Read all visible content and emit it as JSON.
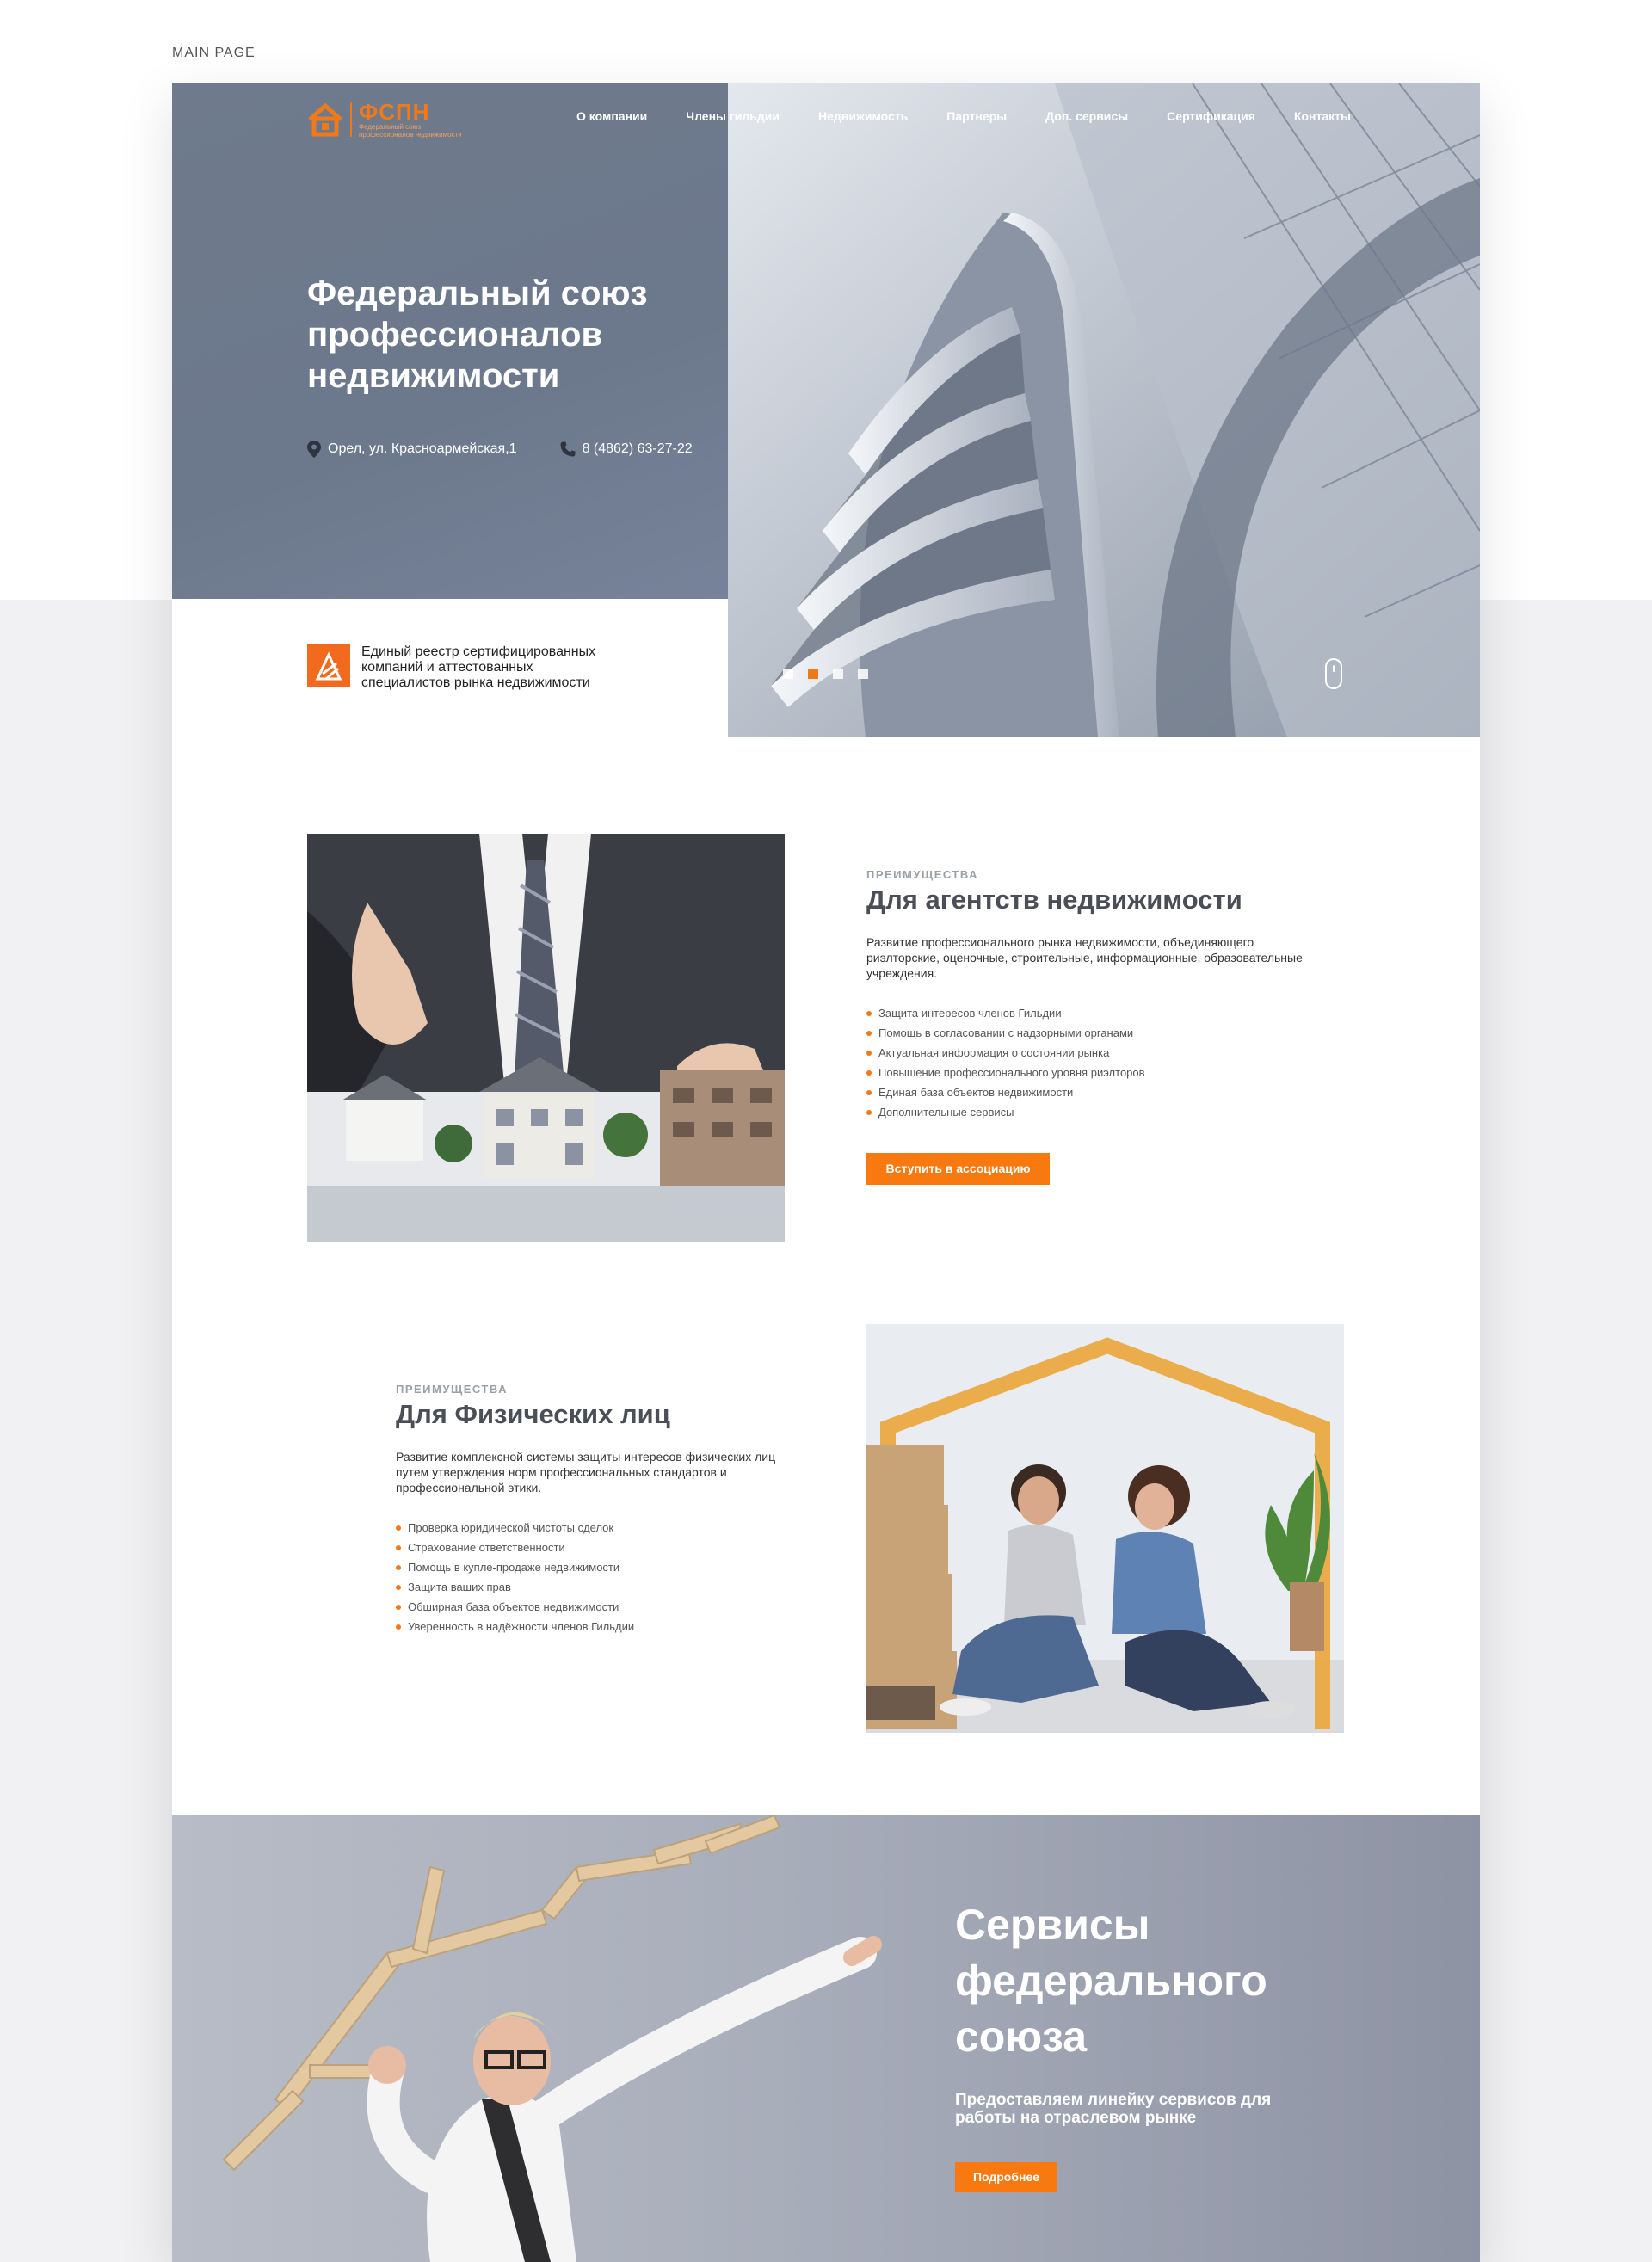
{
  "page_label": "MAIN PAGE",
  "logo": {
    "title": "ФСПН",
    "sub_line1": "Федеральный союз",
    "sub_line2": "профессионалов недвижимости"
  },
  "nav": [
    "О компании",
    "Члены гильдии",
    "Недвижимость",
    "Партнеры",
    "Доп. сервисы",
    "Сертификация",
    "Контакты"
  ],
  "hero": {
    "title": "Федеральный союз профессионалов недвижимости",
    "address": "Орел, ул. Красноармейская,1",
    "phone": "8 (4862) 63-27-22",
    "registry_text": "Единый реестр сертифицированных компаний и аттестованных специалистов рынка недвижимости",
    "slide_count": 4,
    "active_slide": 2
  },
  "agencies": {
    "eyebrow": "ПРЕИМУЩЕСТВА",
    "title": "Для агентств недвижимости",
    "description": "Развитие профессионального рынка недвижимости, объединяющего риэлторские, оценочные, строительные, информационные, образовательные учреждения.",
    "items": [
      "Защита интересов членов Гильдии",
      "Помощь в согласовании с надзорными органами",
      "Актуальная информация о состоянии рынка",
      "Повышение профессионального уровня риэлторов",
      "Единая база объектов недвижимости",
      "Дополнительные сервисы"
    ],
    "button": "Вступить в ассоциацию"
  },
  "individuals": {
    "eyebrow": "ПРЕИМУЩЕСТВА",
    "title": "Для Физических лиц",
    "description": "Развитие комплексной системы защиты интересов физических лиц путем утверждения норм профессиональных стандартов и профессиональной этики.",
    "items": [
      "Проверка юридической чистоты сделок",
      "Страхование ответственности",
      "Помощь в купле-продаже недвижимости",
      "Защита ваших прав",
      "Обширная база объектов недвижимости",
      "Уверенность в надёжности членов Гильдии"
    ]
  },
  "services": {
    "title": "Сервисы федерального союза",
    "subtitle": "Предоставляем линейку сервисов для работы на отраслевом рынке",
    "button": "Подробнее"
  },
  "colors": {
    "accent": "#f7790f",
    "hero_panel": "#6f7a8d",
    "page_bg": "#f1f0f2"
  }
}
